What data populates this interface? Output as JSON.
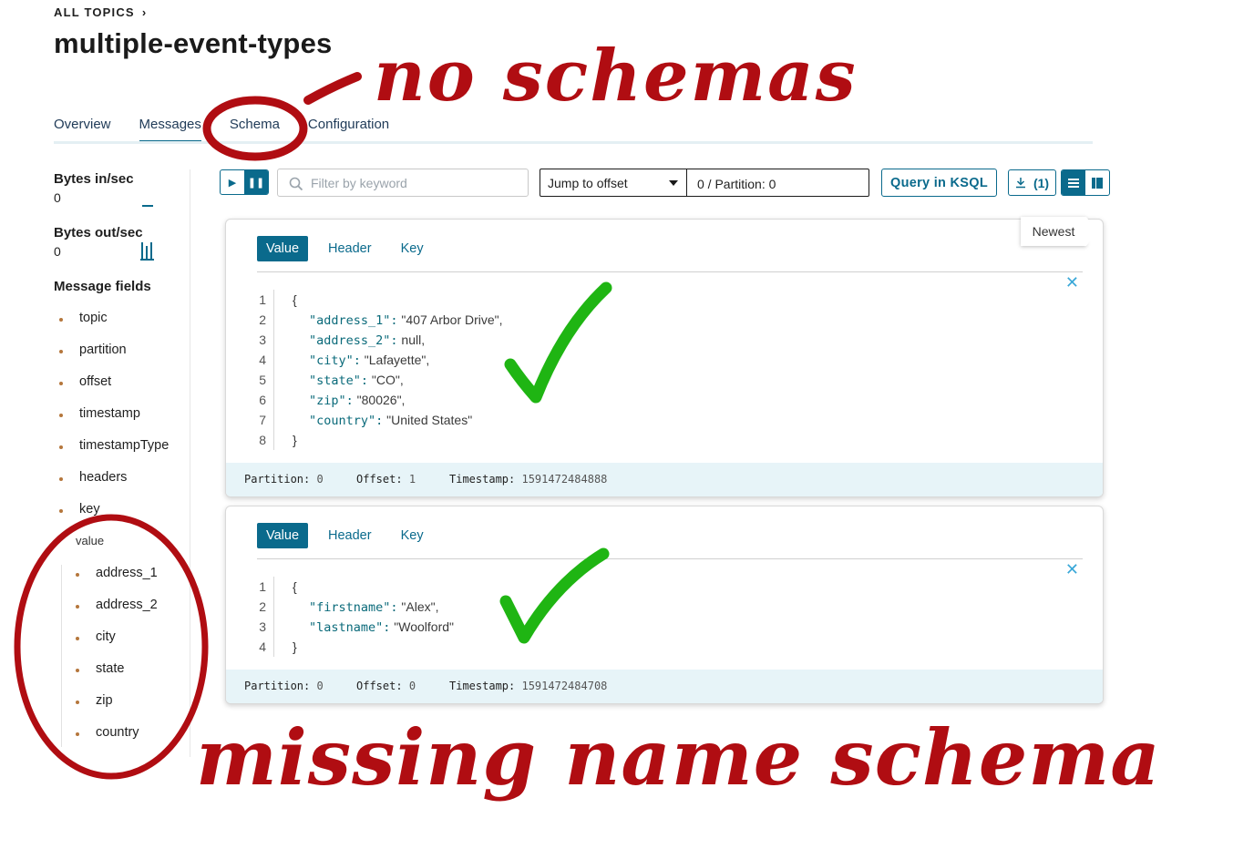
{
  "breadcrumb": {
    "label": "ALL TOPICS",
    "chevron": "›"
  },
  "page_title": "multiple-event-types",
  "tabs": [
    "Overview",
    "Messages",
    "Schema",
    "Configuration"
  ],
  "active_tab": "Messages",
  "sidebar": {
    "bytes_in_label": "Bytes in/sec",
    "bytes_in_value": "0",
    "bytes_out_label": "Bytes out/sec",
    "bytes_out_value": "0",
    "fields_title": "Message fields",
    "fields": [
      "topic",
      "partition",
      "offset",
      "timestamp",
      "timestampType",
      "headers",
      "key"
    ],
    "value_group_label": "value",
    "value_fields": [
      "address_1",
      "address_2",
      "city",
      "state",
      "zip",
      "country"
    ]
  },
  "toolbar": {
    "filter_placeholder": "Filter by keyword",
    "jump_select": "Jump to offset",
    "offset_partition": "0 / Partition: 0",
    "ksql_label": "Query in KSQL",
    "download_label": "(1)",
    "newest_label": "Newest"
  },
  "messages": [
    {
      "tabs": [
        "Value",
        "Header",
        "Key"
      ],
      "lines": [
        {
          "n": "1",
          "text": "{"
        },
        {
          "n": "2",
          "key": "\"address_1\":",
          "val": " \"407 Arbor Drive\","
        },
        {
          "n": "3",
          "key": "\"address_2\":",
          "val": " null,"
        },
        {
          "n": "4",
          "key": "\"city\":",
          "val": " \"Lafayette\","
        },
        {
          "n": "5",
          "key": "\"state\":",
          "val": " \"CO\","
        },
        {
          "n": "6",
          "key": "\"zip\":",
          "val": " \"80026\","
        },
        {
          "n": "7",
          "key": "\"country\":",
          "val": " \"United States\""
        },
        {
          "n": "8",
          "text": "}"
        }
      ],
      "partition_label": "Partition:",
      "partition": "0",
      "offset_label": "Offset:",
      "offset": "1",
      "timestamp_label": "Timestamp:",
      "timestamp": "1591472484888"
    },
    {
      "tabs": [
        "Value",
        "Header",
        "Key"
      ],
      "lines": [
        {
          "n": "1",
          "text": "{"
        },
        {
          "n": "2",
          "key": "\"firstname\":",
          "val": " \"Alex\","
        },
        {
          "n": "3",
          "key": "\"lastname\":",
          "val": " \"Woolford\""
        },
        {
          "n": "4",
          "text": "}"
        }
      ],
      "partition_label": "Partition:",
      "partition": "0",
      "offset_label": "Offset:",
      "offset": "0",
      "timestamp_label": "Timestamp:",
      "timestamp": "1591472484708"
    }
  ],
  "annotations": {
    "top_text": "no schemas",
    "bottom_text": "missing name schema",
    "ink_color": "#b00d12",
    "check_color": "#1fb513"
  },
  "colors": {
    "accent": "#0a6a8c",
    "meta_bg": "#e7f4f8",
    "close_icon": "#3aa8d8"
  }
}
